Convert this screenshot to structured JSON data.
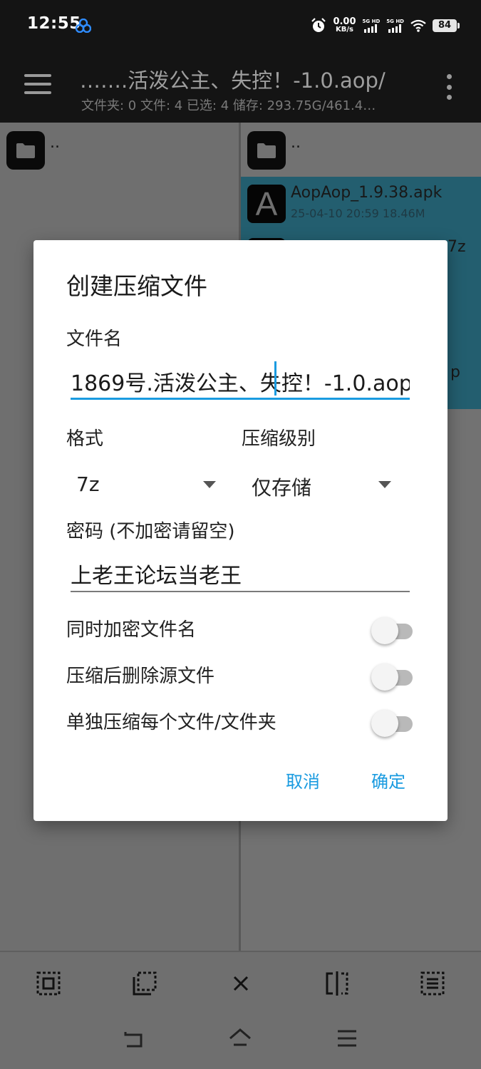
{
  "status_bar": {
    "time": "12:55",
    "net_speed_value": "0.00",
    "net_speed_unit": "KB/s",
    "sim1_label": "5G HD",
    "sim2_label": "5G HD",
    "battery": "84"
  },
  "app_bar": {
    "path": "…….活泼公主、失控！-1.0.aop/",
    "summary": "文件夹: 0  文件: 4  已选: 4  储存: 293.75G/461.4…"
  },
  "left_pane": {
    "parent_label": ".."
  },
  "right_pane": {
    "parent_label": "..",
    "selected_file": {
      "name": "AopAop_1.9.38.apk",
      "meta": "25-04-10 20:59  18.46M",
      "icon_letter": "A"
    },
    "peek_text_1": "7z",
    "peek_text_2": "p"
  },
  "dialog": {
    "title": "创建压缩文件",
    "filename_label": "文件名",
    "filename_value": "1869号.活泼公主、失控！-1.0.aop",
    "format_label": "格式",
    "format_value": "7z",
    "level_label": "压缩级别",
    "level_value": "仅存储",
    "password_label": "密码 (不加密请留空)",
    "password_value": "上老王论坛当老王",
    "options": [
      {
        "label": "同时加密文件名",
        "on": false
      },
      {
        "label": "压缩后删除源文件",
        "on": false
      },
      {
        "label": "单独压缩每个文件/文件夹",
        "on": false
      }
    ],
    "cancel_label": "取消",
    "ok_label": "确定",
    "accent_color": "#1a9be0"
  },
  "toolbar": {
    "icons": [
      "select-all-icon",
      "select-range-icon",
      "close-icon",
      "invert-selection-icon",
      "select-list-icon"
    ]
  },
  "nav_bar": {
    "icons": [
      "back-icon",
      "home-icon",
      "recents-icon"
    ]
  }
}
